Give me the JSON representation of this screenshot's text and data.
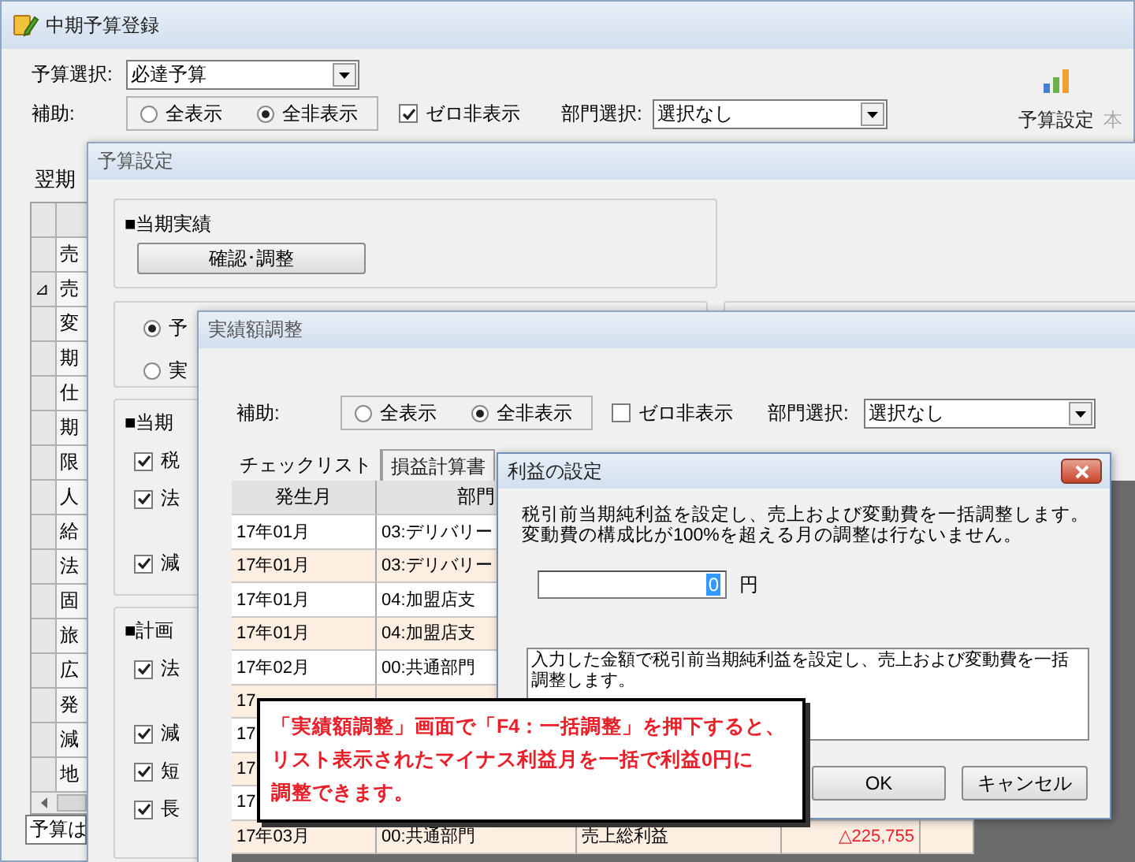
{
  "main_window": {
    "title": "中期予算登録",
    "budget_select": {
      "label": "予算選択:",
      "value": "必達予算"
    },
    "assist": {
      "label": "補助:",
      "options": [
        {
          "label": "全表示",
          "selected": false
        },
        {
          "label": "全非表示",
          "selected": true
        }
      ]
    },
    "zero_hide": {
      "label": "ゼロ非表示",
      "checked": true
    },
    "dept_select": {
      "label": "部門選択:",
      "value": "選択なし"
    },
    "toolbar": [
      {
        "label": "予算設定",
        "kind": "chart",
        "disabled": false
      },
      {
        "label": "本",
        "kind": "text",
        "disabled": true
      }
    ],
    "tab": "翌期",
    "grid": {
      "rows": [
        {
          "marker": "",
          "label": ""
        },
        {
          "marker": "",
          "label": "売"
        },
        {
          "marker": "⊿",
          "label": "売"
        },
        {
          "marker": "",
          "label": "変"
        },
        {
          "marker": "",
          "label": "期"
        },
        {
          "marker": "",
          "label": "仕"
        },
        {
          "marker": "",
          "label": "期"
        },
        {
          "marker": "",
          "label": "限"
        },
        {
          "marker": "",
          "label": "人"
        },
        {
          "marker": "",
          "label": "給"
        },
        {
          "marker": "",
          "label": "法"
        },
        {
          "marker": "",
          "label": "固"
        },
        {
          "marker": "",
          "label": "旅"
        },
        {
          "marker": "",
          "label": "広"
        },
        {
          "marker": "",
          "label": "発"
        },
        {
          "marker": "",
          "label": "減"
        },
        {
          "marker": "",
          "label": "地"
        }
      ]
    },
    "status_field": "予算は"
  },
  "budget_settings_window": {
    "title": "予算設定",
    "current_actual": {
      "heading": "■当期実績",
      "button": "確認･調整"
    },
    "basis": [
      {
        "label": "予",
        "selected": true
      },
      {
        "label": "実",
        "selected": false
      }
    ],
    "current": {
      "heading": "■当期",
      "options": [
        {
          "label": "税",
          "checked": true
        },
        {
          "label": "法",
          "checked": true
        },
        {
          "label": "減",
          "checked": true
        }
      ]
    },
    "plan": {
      "heading": "■計画",
      "options": [
        {
          "label": "法",
          "checked": true
        },
        {
          "label": "減",
          "checked": true
        },
        {
          "label": "短",
          "checked": true
        },
        {
          "label": "長",
          "checked": true
        }
      ]
    }
  },
  "actual_adjust_window": {
    "title": "実績額調整",
    "assist": {
      "label": "補助:",
      "options": [
        {
          "label": "全表示",
          "selected": false
        },
        {
          "label": "全非表示",
          "selected": true
        }
      ]
    },
    "zero_hide": {
      "label": "ゼロ非表示",
      "checked": false
    },
    "dept_select": {
      "label": "部門選択:",
      "value": "選択なし"
    },
    "tabs": [
      {
        "label": "チェックリスト",
        "selected": true
      },
      {
        "label": "損益計算書",
        "selected": false
      }
    ],
    "table": {
      "columns": [
        "発生月",
        "部門"
      ],
      "rows": [
        {
          "month": "17年01月",
          "dept": "03:デリバリー"
        },
        {
          "month": "17年01月",
          "dept": "03:デリバリー"
        },
        {
          "month": "17年01月",
          "dept": "04:加盟店支"
        },
        {
          "month": "17年01月",
          "dept": "04:加盟店支"
        },
        {
          "month": "17年02月",
          "dept": "00:共通部門"
        },
        {
          "month": "17"
        },
        {
          "month": "17"
        },
        {
          "month": "17"
        },
        {
          "month": "17"
        },
        {
          "month": "17年03月",
          "dept": "00:共通部門",
          "item": "売上総利益",
          "amount": "△225,755",
          "negative": true
        }
      ]
    }
  },
  "profit_dialog": {
    "title": "利益の設定",
    "message": [
      "税引前当期純利益を設定し、売上および変動費を一括調整します。",
      "変動費の構成比が100%を超える月の調整は行ないません。"
    ],
    "amount": {
      "value": "0",
      "unit": "円"
    },
    "description": [
      "入力した金額で税引前当期純利益を設定し、売上および変動費を一括",
      "調整します。"
    ],
    "buttons": [
      "OK",
      "キャンセル"
    ]
  },
  "callout": {
    "lines": [
      "「実績額調整」画面で「F4：一括調整」を押下すると、",
      "リスト表示されたマイナス利益月を一括で利益0円に",
      "調整できます。"
    ]
  }
}
